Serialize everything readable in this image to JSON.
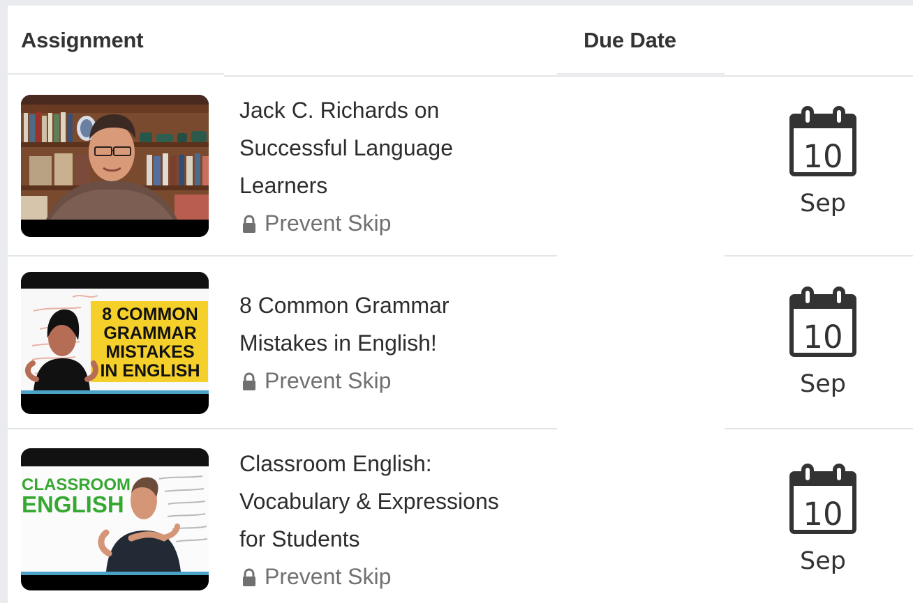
{
  "table": {
    "header": {
      "assignment": "Assignment",
      "due_date": "Due Date"
    },
    "rows": [
      {
        "title_lines": [
          "Jack C. Richards on",
          "Successful Language",
          "Learners"
        ],
        "skip_label": "Prevent Skip",
        "due_day": "10",
        "due_month": "Sep"
      },
      {
        "title_lines": [
          "8 Common Grammar",
          "Mistakes in English!"
        ],
        "skip_label": "Prevent Skip",
        "due_day": "10",
        "due_month": "Sep",
        "thumbnail_text": [
          "8 COMMON",
          "GRAMMAR",
          "MISTAKES",
          "IN ENGLISH"
        ]
      },
      {
        "title_lines": [
          "Classroom English:",
          "Vocabulary & Expressions",
          "for Students"
        ],
        "skip_label": "Prevent Skip",
        "due_day": "10",
        "due_month": "Sep",
        "thumbnail_text": [
          "CLASSROOM",
          "ENGLISH"
        ]
      }
    ]
  },
  "colors": {
    "thumbnail_yellow": "#f5cf2a",
    "thumbnail_green": "#33ad2b",
    "text_dark": "#2d2d2d",
    "text_muted": "#707070"
  },
  "icons": {
    "lock": "lock-icon",
    "calendar": "calendar-icon"
  }
}
